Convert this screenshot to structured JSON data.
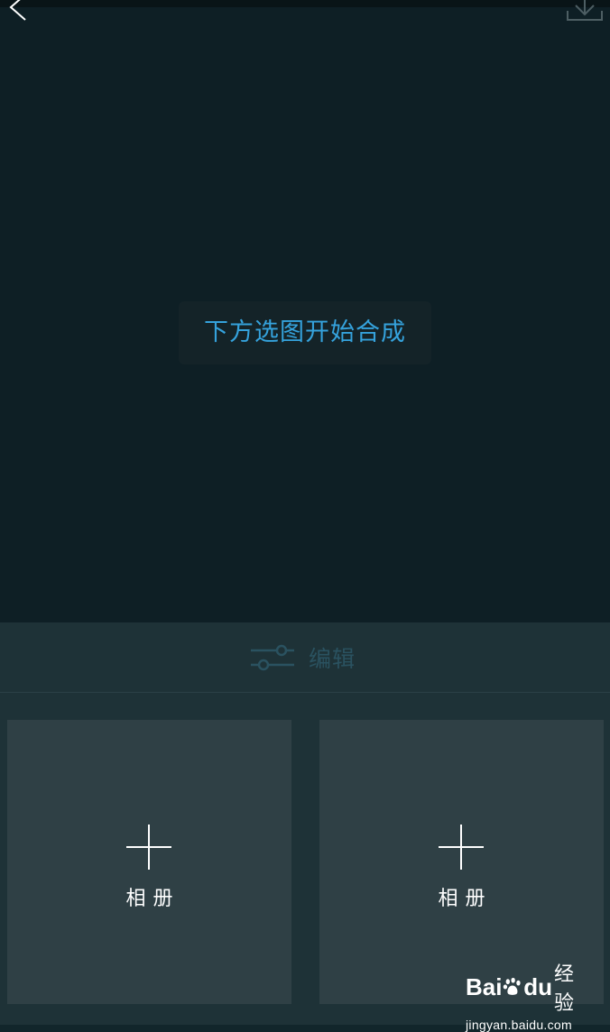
{
  "toast": {
    "text": "下方选图开始合成"
  },
  "edit_bar": {
    "label": "编辑",
    "icon": "sliders-icon"
  },
  "slots": [
    {
      "label": "相册",
      "icon": "plus-icon"
    },
    {
      "label": "相册",
      "icon": "plus-icon"
    }
  ],
  "header": {
    "back_icon": "back-arrow-icon",
    "download_icon": "download-icon"
  },
  "watermark": {
    "brand_left": "Bai",
    "brand_right": "du",
    "product": "经验",
    "url": "jingyan.baidu.com"
  },
  "colors": {
    "background": "#0e1f25",
    "panel": "#1e3237",
    "slot": "#2f4045",
    "accent": "#35a2dc",
    "edit_muted": "#2a5260"
  }
}
